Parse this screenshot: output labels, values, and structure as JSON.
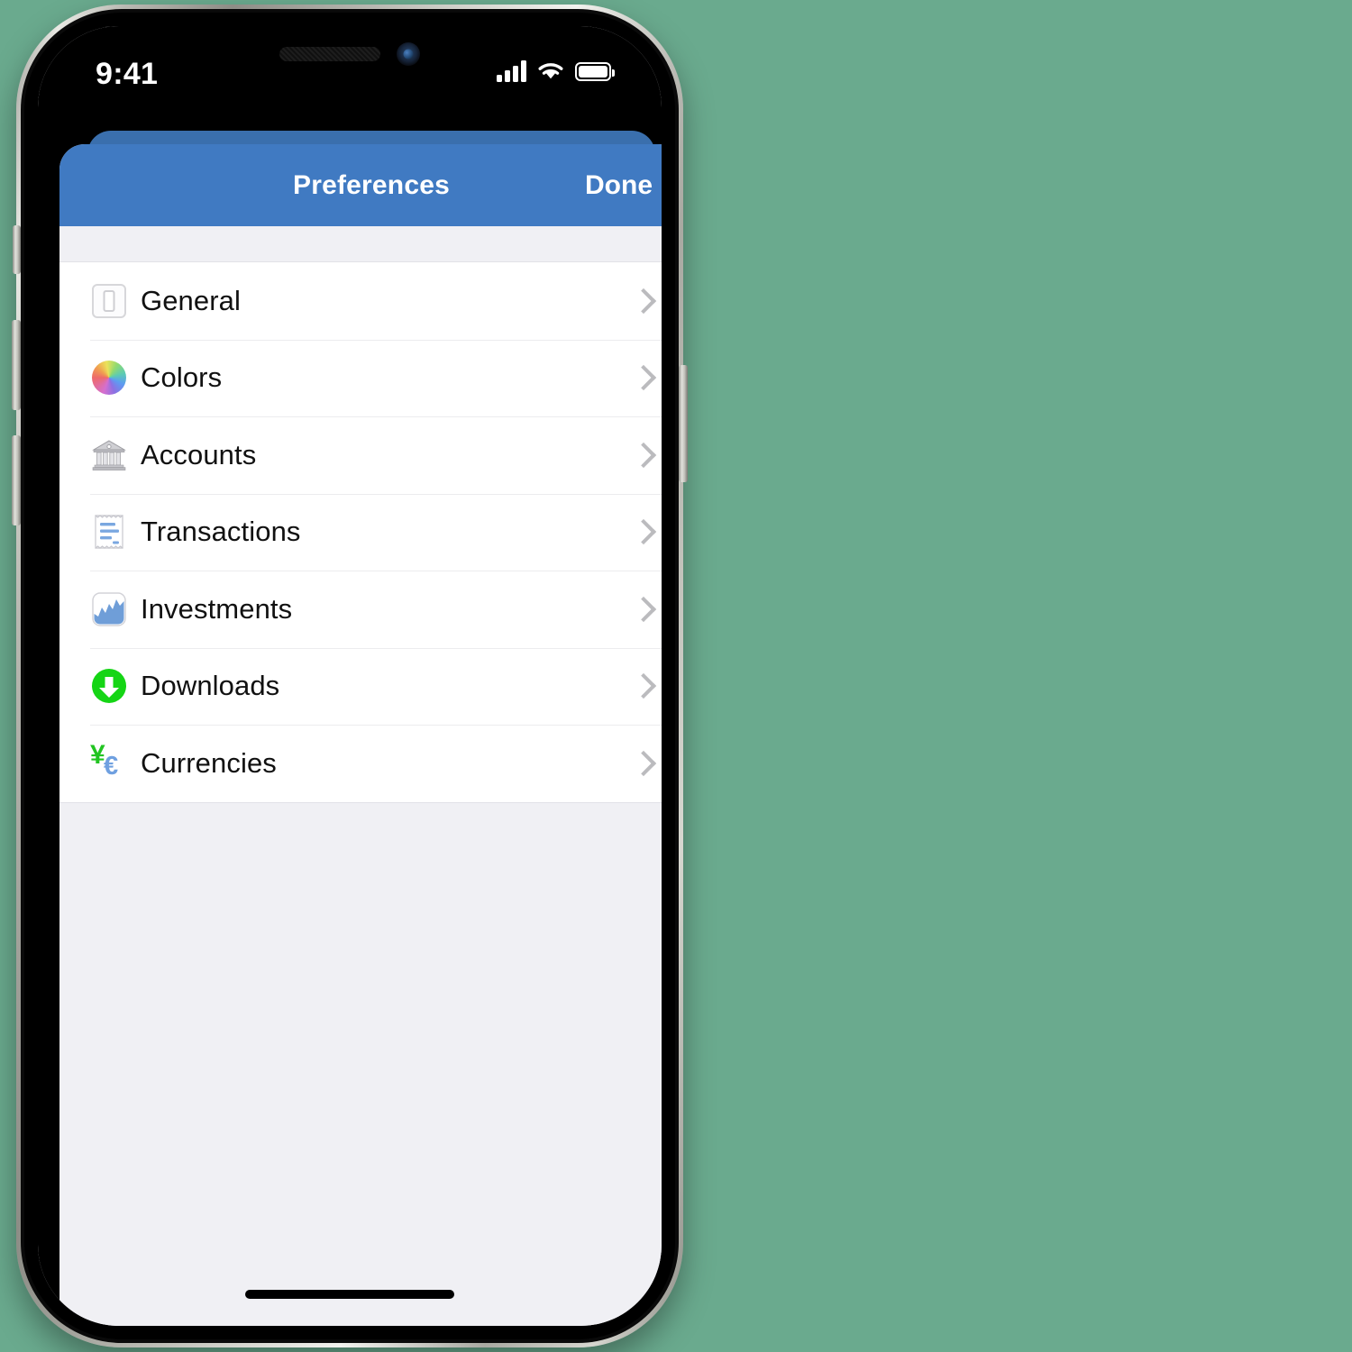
{
  "status_bar": {
    "time": "9:41",
    "signal_icon": "cellular-bars-icon",
    "signal_bars": 4,
    "wifi_icon": "wifi-icon",
    "battery_icon": "battery-full-icon"
  },
  "modal": {
    "nav": {
      "title": "Preferences",
      "done_label": "Done"
    },
    "items": [
      {
        "label": "General",
        "icon": "light-switch-icon"
      },
      {
        "label": "Colors",
        "icon": "color-wheel-icon"
      },
      {
        "label": "Accounts",
        "icon": "bank-building-icon"
      },
      {
        "label": "Transactions",
        "icon": "receipt-icon"
      },
      {
        "label": "Investments",
        "icon": "chart-icon"
      },
      {
        "label": "Downloads",
        "icon": "download-circle-icon"
      },
      {
        "label": "Currencies",
        "icon": "currency-yen-euro-icon"
      }
    ]
  },
  "colors": {
    "navbar_blue": "#407ac2",
    "back_card_blue": "#3a6fad",
    "list_background": "#ffffff",
    "page_background": "#f0f0f4",
    "chevron_gray": "#bbbbbe",
    "download_green": "#15d515",
    "yen_green": "#22c422",
    "euro_blue": "#6fa0e0"
  }
}
